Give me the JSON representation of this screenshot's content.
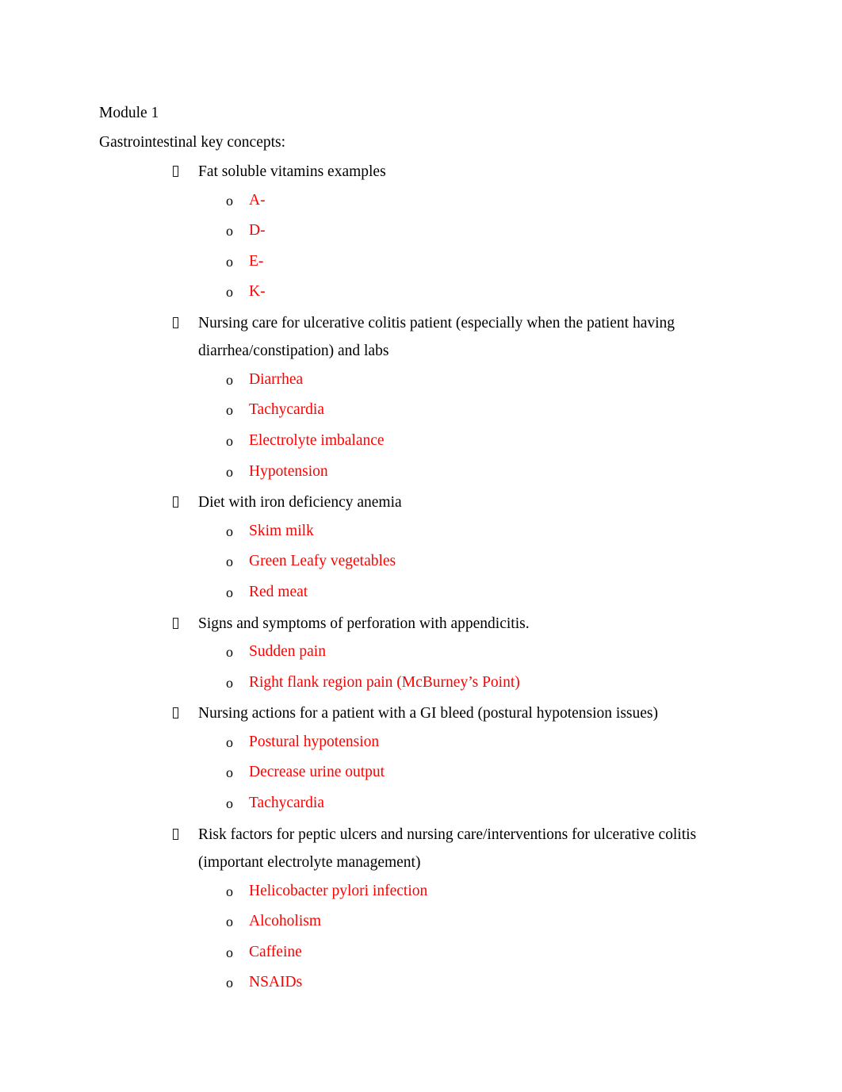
{
  "document": {
    "title_line": "Module 1",
    "subtitle_line": "Gastrointestinal key concepts:",
    "bullet_glyph": "tofu-box-icon",
    "sub_bullet_marker": "o",
    "colors": {
      "body_text": "#000000",
      "answer_text": "#ff0000",
      "page_background": "#ffffff"
    },
    "sections": [
      {
        "heading": "Fat soluble vitamins examples",
        "items": [
          "A-",
          "D-",
          "E-",
          "K-"
        ]
      },
      {
        "heading": "Nursing care for ulcerative colitis patient (especially when the patient having diarrhea/constipation) and labs",
        "items": [
          "Diarrhea",
          "Tachycardia",
          "Electrolyte imbalance",
          "Hypotension"
        ]
      },
      {
        "heading": "Diet with iron deficiency anemia",
        "items": [
          "Skim milk",
          "Green Leafy vegetables",
          "Red meat"
        ]
      },
      {
        "heading": "Signs and symptoms of perforation with appendicitis.",
        "items": [
          "Sudden pain",
          "Right flank region pain (McBurney’s Point)"
        ]
      },
      {
        "heading": "Nursing actions for a patient with a GI bleed (postural hypotension issues)",
        "items": [
          "Postural hypotension",
          "Decrease urine output",
          "Tachycardia"
        ]
      },
      {
        "heading": "Risk factors for peptic ulcers and nursing care/interventions for ulcerative colitis (important electrolyte management)",
        "items": [
          "Helicobacter pylori infection",
          "Alcoholism",
          "Caffeine",
          "NSAIDs"
        ]
      }
    ]
  }
}
